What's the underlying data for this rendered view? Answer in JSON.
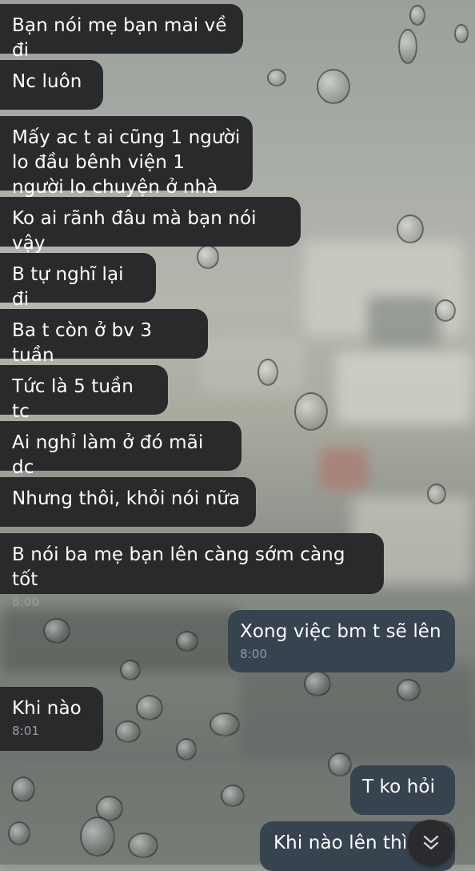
{
  "messages": [
    {
      "text": "Bạn nói mẹ bạn mai về đi"
    },
    {
      "text": "Nc luôn"
    },
    {
      "text": "Mấy ac t ai cũng 1 người lo đầu bênh viện 1 người lo chuyện ở nhà"
    },
    {
      "text": "Ko ai rãnh đâu mà bạn nói vậy"
    },
    {
      "text": "B tự nghĩ lại đi"
    },
    {
      "text": "Ba t còn ở bv 3 tuần"
    },
    {
      "text": "Tức là 5 tuần tc"
    },
    {
      "text": "Ai nghỉ làm ở đó mãi dc"
    },
    {
      "text": "Nhưng thôi, khỏi nói nữa"
    },
    {
      "text": "B nói ba mẹ bạn lên càng sớm càng tốt",
      "time": "8:00"
    },
    {
      "text": "Xong việc bm t sẽ lên",
      "time": "8:00"
    },
    {
      "text": "Khi nào",
      "time": "8:01"
    },
    {
      "text": "T ko hỏi"
    },
    {
      "text": "Khi nào lên thì"
    }
  ],
  "scroll_button": {
    "icon": "double-chevron-down-icon"
  },
  "colors": {
    "incoming_bubble": "#2a2a2c",
    "outgoing_bubble": "#37434f",
    "time": "#9b9da1"
  }
}
